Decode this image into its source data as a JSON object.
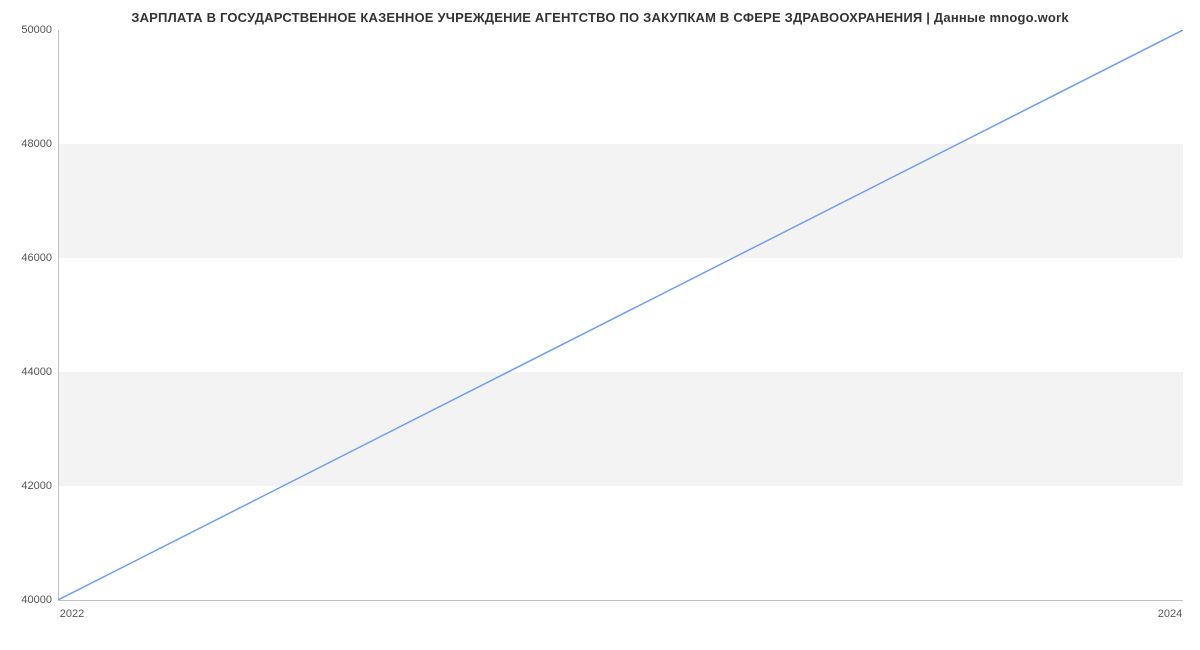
{
  "chart_data": {
    "type": "line",
    "title": "ЗАРПЛАТА В ГОСУДАРСТВЕННОЕ КАЗЕННОЕ УЧРЕЖДЕНИЕ АГЕНТСТВО ПО ЗАКУПКАМ В СФЕРЕ ЗДРАВООХРАНЕНИЯ | Данные mnogo.work",
    "x": [
      2022,
      2024
    ],
    "values": [
      40000,
      50000
    ],
    "xlabel": "",
    "ylabel": "",
    "ylim": [
      40000,
      50000
    ],
    "xlim": [
      2022,
      2024
    ],
    "y_ticks": [
      40000,
      42000,
      44000,
      46000,
      48000,
      50000
    ],
    "x_ticks": [
      2022,
      2024
    ],
    "line_color": "#6f9ef0",
    "band_color": "#f3f3f3"
  }
}
